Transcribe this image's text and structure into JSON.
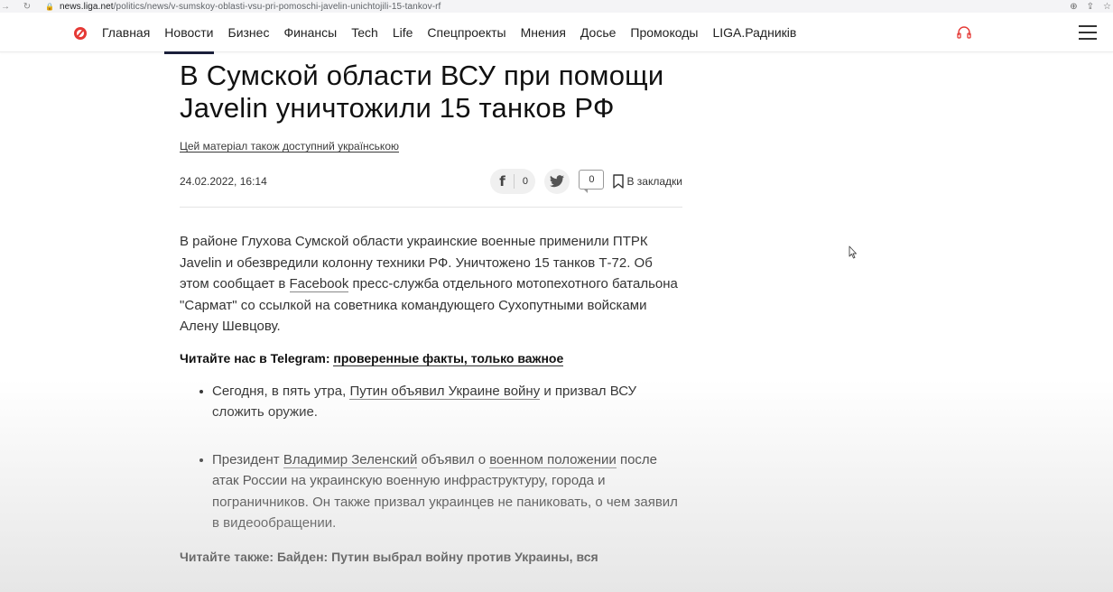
{
  "browser": {
    "url_host": "news.liga.net",
    "url_path": "/politics/news/v-sumskoy-oblasti-vsu-pri-pomoschi-javelin-unichtojili-15-tankov-rf"
  },
  "nav": {
    "items": [
      {
        "label": "Главная"
      },
      {
        "label": "Новости"
      },
      {
        "label": "Бизнес"
      },
      {
        "label": "Финансы"
      },
      {
        "label": "Tech"
      },
      {
        "label": "Life"
      },
      {
        "label": "Спецпроекты"
      },
      {
        "label": "Мнения"
      },
      {
        "label": "Досье"
      },
      {
        "label": "Промокоды"
      },
      {
        "label": "LIGA.Радників"
      }
    ],
    "active_index": 1,
    "accent_color": "#e53935"
  },
  "article": {
    "title": "В Сумской области ВСУ при помощи Javelin уничтожили 15 танков РФ",
    "ua_link": "Цей матеріал також доступний українською",
    "date": "24.02.2022, 16:14",
    "share": {
      "facebook_count": "0",
      "comments_count": "0",
      "bookmark_label": "В закладки"
    },
    "lead": {
      "part1": "В районе Глухова Сумской области украинские военные применили ПТРК Javelin и обезвредили колонну техники РФ. Уничтожено 15 танков Т-72. Об этом сообщает в ",
      "link": "Facebook",
      "part2": " пресс-служба отдельного мотопехотного батальона \"Сармат\" со ссылкой на советника командующего Сухопутными войсками Алену Шевцову."
    },
    "telegram": {
      "prefix": "Читайте нас в Telegram: ",
      "link": "проверенные факты, только важное"
    },
    "bullets": [
      {
        "t1": "Сегодня, в пять утра, ",
        "l1": "Путин объявил Украине войну",
        "t2": " и призвал ВСУ сложить оружие.",
        "l2": "",
        "t3": ""
      },
      {
        "t1": "Президент ",
        "l1": "Владимир Зеленский",
        "t2": " объявил о ",
        "l2": "военном положении",
        "t3": " после атак России на украинскую военную инфраструктуру, города и пограничников. Он также призвал украинцев не паниковать, о чем заявил в видеообращении."
      }
    ],
    "also": "Читайте также: Байден: Путин выбрал войну против Украины, вся"
  }
}
